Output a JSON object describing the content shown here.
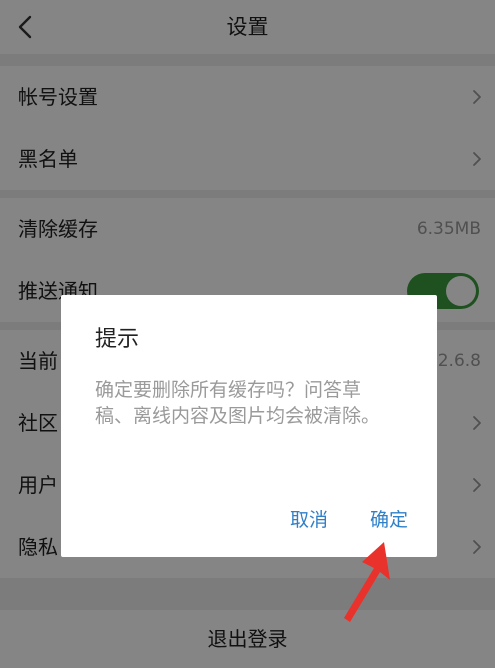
{
  "header": {
    "title": "设置"
  },
  "rows": [
    {
      "label": "帐号设置"
    },
    {
      "label": "黑名单"
    },
    {
      "label": "清除缓存",
      "value": "6.35MB"
    },
    {
      "label": "推送通知"
    },
    {
      "label": "当前",
      "value": "2.6.8"
    },
    {
      "label": "社区"
    },
    {
      "label": "用户"
    },
    {
      "label": "隐私"
    }
  ],
  "logout": {
    "label": "退出登录"
  },
  "dialog": {
    "title": "提示",
    "message": "确定要删除所有缓存吗？问答草稿、离线内容及图片均会被清除。",
    "cancel_label": "取消",
    "confirm_label": "确定"
  },
  "colors": {
    "toggle_on": "#3a9a3f",
    "dialog_button": "#2f80c8",
    "annotation_arrow": "#e8322b"
  },
  "icons": {
    "back": "chevron-left-icon",
    "row_arrow": "chevron-right-icon"
  }
}
